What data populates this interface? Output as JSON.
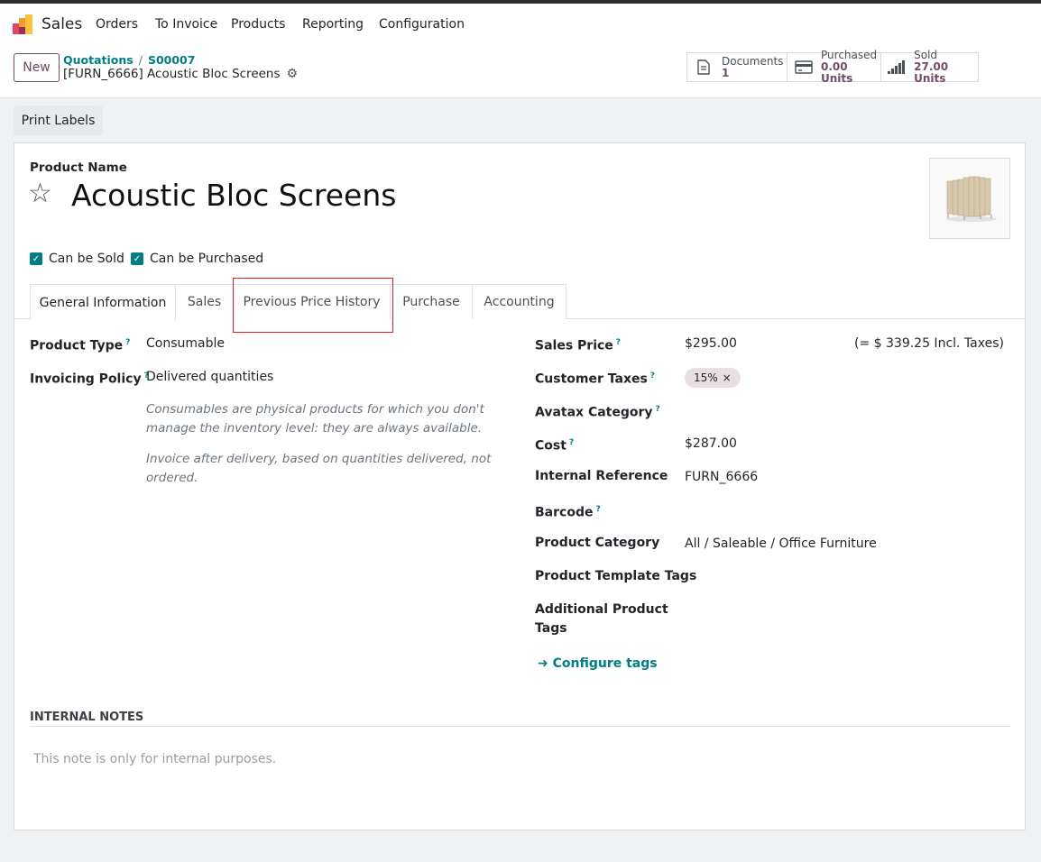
{
  "navbar": {
    "app_name": "Sales",
    "menu": [
      "Orders",
      "To Invoice",
      "Products",
      "Reporting",
      "Configuration"
    ]
  },
  "control_panel": {
    "new_label": "New",
    "breadcrumb": {
      "parent": "Quotations",
      "separator": "/",
      "current": "S00007"
    },
    "record_title": "[FURN_6666] Acoustic Bloc Screens",
    "stats": [
      {
        "label": "Documents",
        "value": "1",
        "icon": "file-icon"
      },
      {
        "label": "Purchased",
        "value": "0.00 Units",
        "icon": "credit-card-icon"
      },
      {
        "label": "Sold",
        "value": "27.00 Units",
        "icon": "signal-bars-icon"
      }
    ]
  },
  "actions": {
    "print_labels": "Print Labels"
  },
  "form": {
    "product_name_label": "Product Name",
    "product_name": "Acoustic Bloc Screens",
    "checkboxes": [
      {
        "label": "Can be Sold",
        "checked": true
      },
      {
        "label": "Can be Purchased",
        "checked": true
      }
    ],
    "tabs": [
      "General Information",
      "Sales",
      "Previous Price History",
      "Purchase",
      "Accounting"
    ],
    "active_tab": "General Information",
    "left": {
      "product_type_label": "Product Type",
      "product_type": "Consumable",
      "invoicing_policy_label": "Invoicing Policy",
      "invoicing_policy": "Delivered quantities",
      "note_consumable": "Consumables are physical products for which you don't manage the inventory level: they are always available.",
      "note_invoice": "Invoice after delivery, based on quantities delivered, not ordered."
    },
    "right": {
      "sales_price_label": "Sales Price",
      "sales_price": "$295.00",
      "incl_taxes": "(= $ 339.25 Incl. Taxes)",
      "customer_taxes_label": "Customer Taxes",
      "customer_tax_tag": "15%",
      "avatax_label": "Avatax Category",
      "cost_label": "Cost",
      "cost": "$287.00",
      "internal_ref_label": "Internal Reference",
      "internal_ref": "FURN_6666",
      "barcode_label": "Barcode",
      "product_category_label": "Product Category",
      "product_category": "All / Saleable / Office Furniture",
      "template_tags_label": "Product Template Tags",
      "additional_tags_label_1": "Additional Product",
      "additional_tags_label_2": "Tags",
      "configure_tags": "Configure tags"
    },
    "internal_notes_title": "INTERNAL NOTES",
    "internal_notes_placeholder": "This note is only for internal purposes."
  },
  "colors": {
    "brand": "#714b67",
    "accent": "#017e84",
    "highlight": "#e02020"
  }
}
